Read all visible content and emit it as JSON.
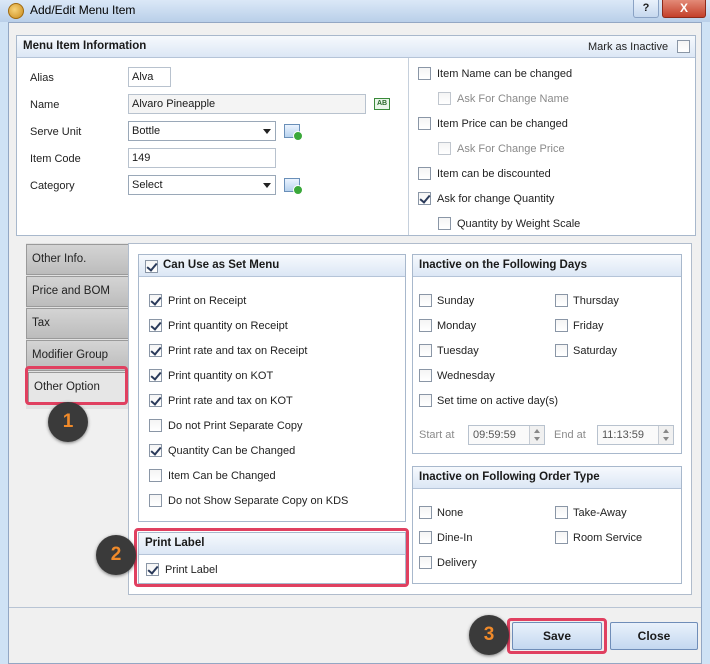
{
  "window": {
    "title": "Add/Edit Menu Item",
    "help": "?",
    "close": "X"
  },
  "info": {
    "header": "Menu Item Information",
    "mark_inactive": "Mark as Inactive",
    "labels": {
      "alias": "Alias",
      "name": "Name",
      "serve_unit": "Serve Unit",
      "item_code": "Item Code",
      "category": "Category"
    },
    "values": {
      "alias": "Alva",
      "name": "Alvaro  Pineapple",
      "serve_unit": "Bottle",
      "item_code": "149",
      "category": "Select"
    },
    "name_icon_text": "AB",
    "options": {
      "name_changed": "Item Name can be changed",
      "ask_name": "Ask For Change Name",
      "price_changed": "Item Price can be changed",
      "ask_price": "Ask For Change Price",
      "discounted": "Item can be discounted",
      "ask_qty": "Ask for change Quantity",
      "qty_weight": "Quantity by Weight Scale"
    }
  },
  "tabs": [
    "Other Info.",
    "Price and BOM",
    "Tax",
    "Modifier Group",
    "Other Option"
  ],
  "set_menu": {
    "header": "Can Use as Set Menu",
    "items": [
      "Print on Receipt",
      "Print quantity on Receipt",
      "Print rate and tax on Receipt",
      "Print quantity on KOT",
      "Print rate and tax on KOT",
      "Do not Print Separate Copy",
      "Quantity Can be Changed",
      "Item Can be Changed",
      "Do not Show Separate Copy on KDS"
    ]
  },
  "print_label": {
    "header": "Print Label",
    "option": "Print Label"
  },
  "inactive_days": {
    "header": "Inactive on the Following Days",
    "days": [
      "Sunday",
      "Thursday",
      "Monday",
      "Friday",
      "Tuesday",
      "Saturday",
      "Wednesday"
    ],
    "set_time": "Set time on active day(s)",
    "start_label": "Start at",
    "start_value": "09:59:59",
    "end_label": "End at",
    "end_value": "11:13:59"
  },
  "order_type": {
    "header": "Inactive on Following Order Type",
    "types": [
      "None",
      "Take-Away",
      "Dine-In",
      "Room Service",
      "Delivery"
    ]
  },
  "buttons": {
    "save": "Save",
    "close": "Close"
  },
  "badges": [
    "1",
    "2",
    "3"
  ],
  "colors": {
    "highlight": "#e04060",
    "badge_bg": "#3a3a3a",
    "badge_text": "#f08a2a"
  }
}
